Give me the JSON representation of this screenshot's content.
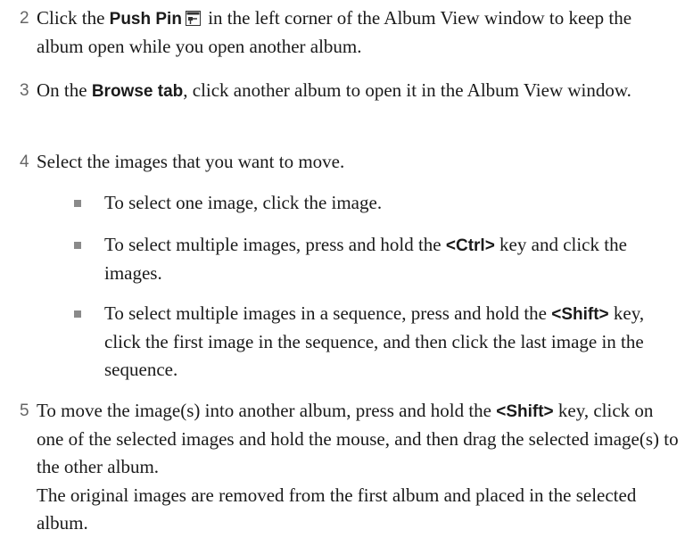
{
  "steps": [
    {
      "number": "2",
      "text_before": "Click the ",
      "ui_label": "Push Pin",
      "icon": "push-pin-icon",
      "text_after": " in the left corner of the Album View window to keep the album open while you open another album."
    },
    {
      "number": "3",
      "text_before": "On the ",
      "ui_label": "Browse tab",
      "text_after": ", click another album to open it in the Album View window."
    },
    {
      "number": "4",
      "text": "Select the images that you want to move."
    },
    {
      "number": "5",
      "text_before": "To move the image(s) into another album, press and hold the ",
      "key_label": "<Shift>",
      "text_after": " key, click on one of the selected images and hold the mouse, and then drag the selected image(s) to the other album."
    }
  ],
  "bullets": [
    {
      "text": "To select one image, click the image."
    },
    {
      "text_before": "To select multiple images, press and hold the ",
      "key_label": "<Ctrl>",
      "text_after": " key and click the images."
    },
    {
      "text_before": "To select multiple images in a sequence, press and hold the ",
      "key_label": "<Shift>",
      "text_after": " key, click the first image in the sequence, and then click the last image in the sequence."
    }
  ],
  "result_text": "The original images are removed from the first album and placed in the selected album."
}
